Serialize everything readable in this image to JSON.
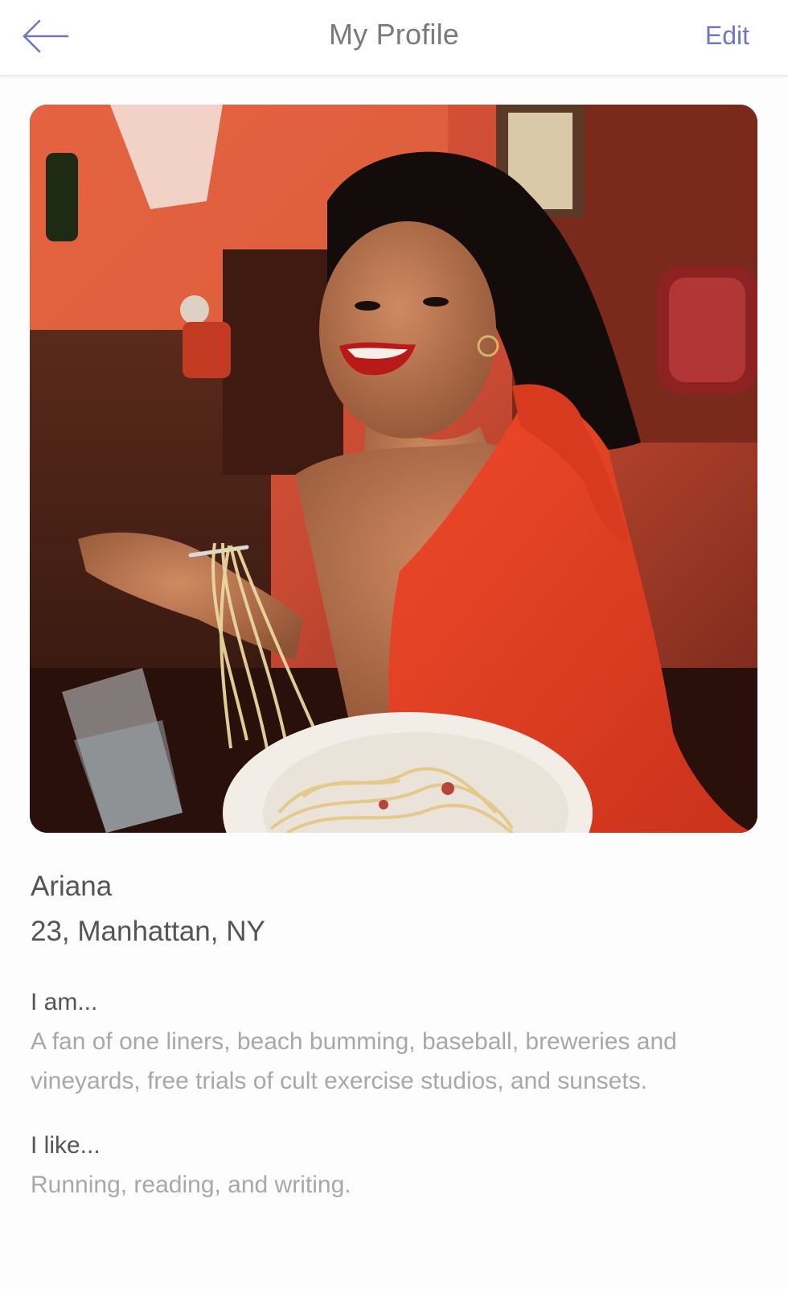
{
  "header": {
    "title": "My Profile",
    "edit_label": "Edit",
    "back_icon": "arrow-left-icon",
    "accent_color": "#6f78bd"
  },
  "profile": {
    "name": "Ariana",
    "age_location": "23, Manhattan, NY",
    "i_am_label": "I am...",
    "i_am_text": "A fan of one liners, beach bumming, baseball, breweries and vineyards, free trials of cult exercise studios, and sunsets.",
    "i_like_label": "I like...",
    "i_like_text": "Running, reading, and writing."
  }
}
